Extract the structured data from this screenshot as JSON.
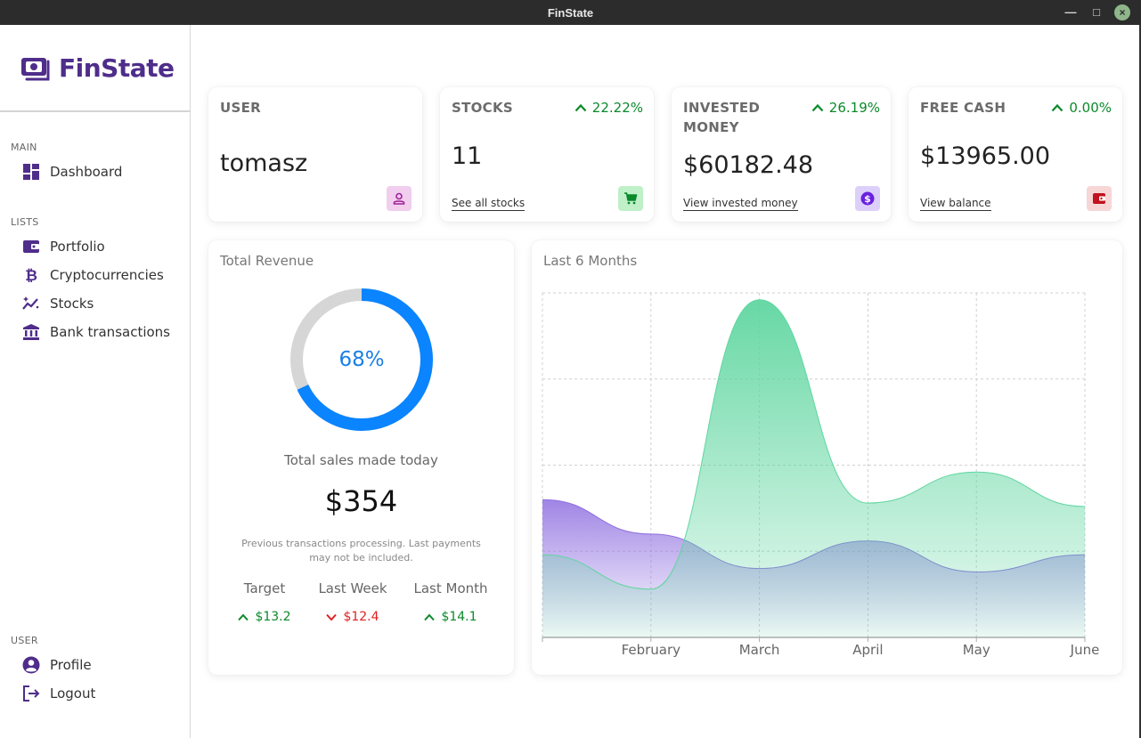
{
  "window": {
    "title": "FinState"
  },
  "sidebar": {
    "logo_text": "FinState",
    "sections": {
      "main": "MAIN",
      "lists": "LISTS",
      "user": "USER"
    },
    "items": {
      "dashboard": "Dashboard",
      "portfolio": "Portfolio",
      "cryptocurrencies": "Cryptocurrencies",
      "stocks": "Stocks",
      "bank_transactions": "Bank transactions",
      "profile": "Profile",
      "logout": "Logout"
    }
  },
  "cards": {
    "user": {
      "label": "USER",
      "value": "tomasz"
    },
    "stocks": {
      "label": "STOCKS",
      "change": "22.22%",
      "value": "11",
      "link": "See all stocks"
    },
    "invested": {
      "label_line1": "INVESTED",
      "label_line2": "MONEY",
      "change": "26.19%",
      "value": "$60182.48",
      "link": "View invested money"
    },
    "cash": {
      "label": "FREE CASH",
      "change": "0.00%",
      "value": "$13965.00",
      "link": "View balance"
    }
  },
  "revenue": {
    "title": "Total Revenue",
    "progress_percent": 68,
    "progress_label": "68%",
    "subtitle": "Total sales made today",
    "amount": "$354",
    "note_line1": "Previous transactions processing. Last payments",
    "note_line2": "may not be included.",
    "stats": [
      {
        "label": "Target",
        "value": "$13.2",
        "trend": "up"
      },
      {
        "label": "Last Week",
        "value": "$12.4",
        "trend": "down"
      },
      {
        "label": "Last Month",
        "value": "$14.1",
        "trend": "up"
      }
    ]
  },
  "colors": {
    "accent_purple": "#4f2d8a",
    "up_green": "#0a8a2a",
    "down_red": "#e32020",
    "donut_blue": "#0a84ff",
    "donut_track": "#d6d6d6",
    "series_green": "#5fd6a0",
    "series_purple": "#8f6fe0"
  },
  "chart_data": {
    "type": "area",
    "title": "Last 6 Months",
    "categories": [
      "",
      "February",
      "March",
      "April",
      "May",
      "June"
    ],
    "ylim": [
      0,
      100
    ],
    "grid": true,
    "series": [
      {
        "color": "#5fd6a0",
        "values": [
          24,
          14,
          98,
          39,
          48,
          38
        ]
      },
      {
        "color": "#8f6fe0",
        "values": [
          40,
          30,
          20,
          28,
          19,
          24
        ]
      }
    ]
  }
}
